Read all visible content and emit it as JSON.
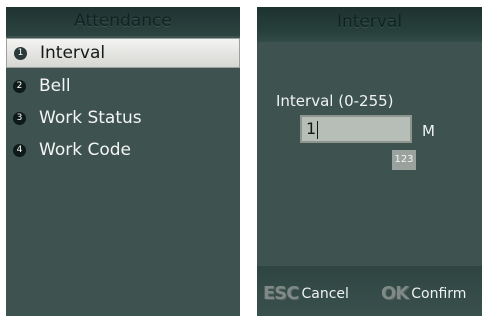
{
  "left_screen": {
    "title": "Attendance",
    "menu": [
      {
        "num": "1",
        "label": "Interval"
      },
      {
        "num": "2",
        "label": "Bell"
      },
      {
        "num": "3",
        "label": "Work Status"
      },
      {
        "num": "4",
        "label": "Work Code"
      }
    ]
  },
  "right_screen": {
    "title": "Interval",
    "field_label": "Interval (0-255)",
    "field_value": "1",
    "unit": "M",
    "input_mode": "123",
    "softkeys": {
      "cancel_key": "ESC",
      "cancel_label": "Cancel",
      "confirm_key": "OK",
      "confirm_label": "Confirm"
    }
  },
  "colors": {
    "screen_bg": "#3e524f",
    "selection_bg": "#f0f0ee",
    "badge_bg": "#9aa29d"
  }
}
